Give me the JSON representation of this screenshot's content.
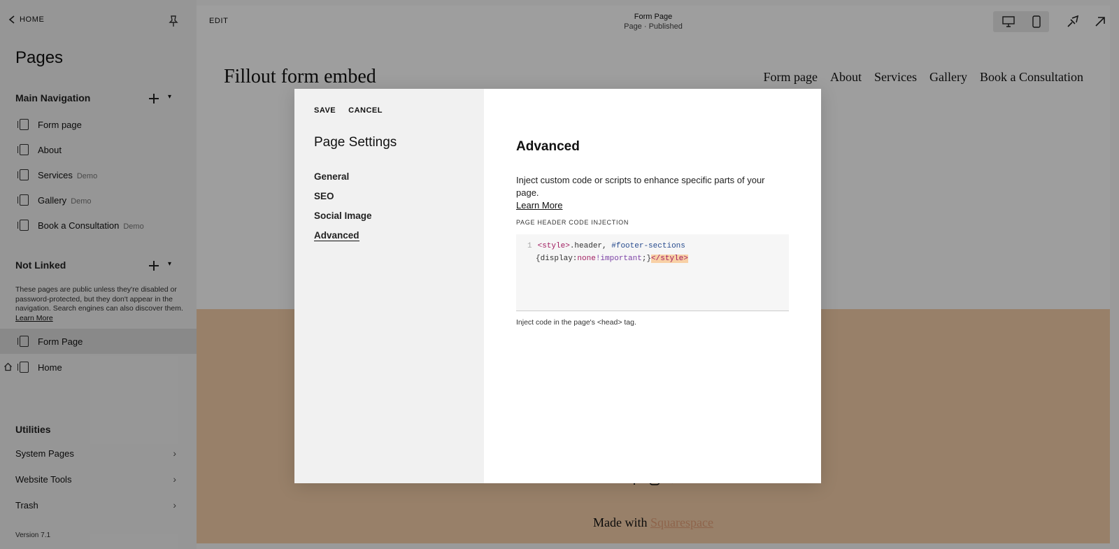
{
  "sidebar": {
    "home_label": "HOME",
    "title": "Pages",
    "main_nav_heading": "Main Navigation",
    "main_nav_items": [
      {
        "label": "Form page",
        "badge": ""
      },
      {
        "label": "About",
        "badge": ""
      },
      {
        "label": "Services",
        "badge": "Demo"
      },
      {
        "label": "Gallery",
        "badge": "Demo"
      },
      {
        "label": "Book a Consultation",
        "badge": "Demo"
      }
    ],
    "not_linked_heading": "Not Linked",
    "not_linked_note": "These pages are public unless they're disabled or password-protected, but they don't appear in the navigation. Search engines can also discover them.",
    "not_linked_learn_more": "Learn More",
    "not_linked_items": [
      {
        "label": "Form Page",
        "active": true
      },
      {
        "label": "Home",
        "active": false
      }
    ],
    "utilities_heading": "Utilities",
    "utilities_items": [
      {
        "label": "System Pages"
      },
      {
        "label": "Website Tools"
      },
      {
        "label": "Trash"
      }
    ],
    "version": "Version 7.1"
  },
  "topbar": {
    "edit_label": "EDIT",
    "page_name": "Form Page",
    "page_status": "Page · Published"
  },
  "site": {
    "title": "Fillout form embed",
    "nav": [
      "Form page",
      "About",
      "Services",
      "Gallery",
      "Book a Consultation"
    ],
    "made_with_prefix": "Made with",
    "made_with_link": "Squarespace"
  },
  "modal": {
    "save_label": "SAVE",
    "cancel_label": "CANCEL",
    "title": "Page Settings",
    "tabs": [
      {
        "label": "General"
      },
      {
        "label": "SEO"
      },
      {
        "label": "Social Image"
      },
      {
        "label": "Advanced"
      }
    ],
    "section_title": "Advanced",
    "description": "Inject custom code or scripts to enhance specific parts of your page.",
    "learn_more": "Learn More",
    "code_label": "PAGE HEADER CODE INJECTION",
    "code_line_number": "1",
    "code": {
      "open_tag": "<style>",
      "selector": ".header, ",
      "selector2": "#footer-sections",
      "brace_open": "{display:",
      "value": "none",
      "important": "!important",
      "brace_close": ";}",
      "close_tag": "</style>"
    },
    "hint": "Inject code in the page's <head> tag."
  },
  "colors": {
    "sidebar_bg": "#f3f3f3",
    "footer_band": "#f5cfaa",
    "link_accent": "#e5a27a",
    "modal_left_bg": "#f1f1f1"
  }
}
